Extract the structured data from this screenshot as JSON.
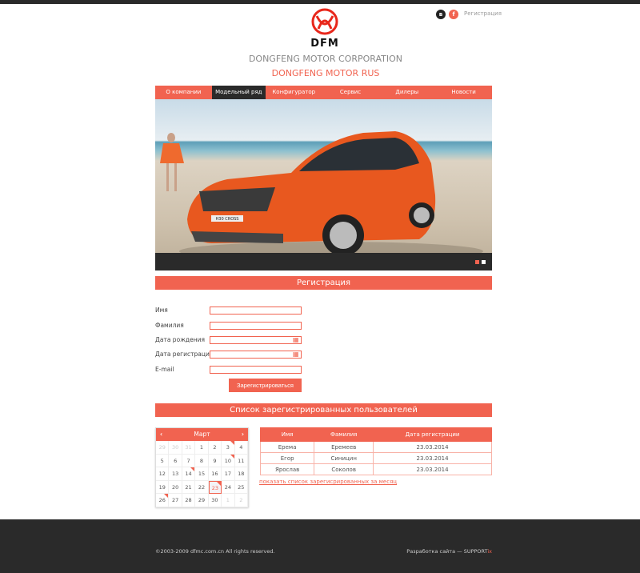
{
  "header": {
    "logo_text": "DFM",
    "social": [
      {
        "label": "в",
        "color": "#222"
      },
      {
        "label": "f",
        "color": "#f16350"
      }
    ],
    "register_link": "Регистрация",
    "title": "DONGFENG MOTOR CORPORATION",
    "subtitle": "DONGFENG MOTOR RUS"
  },
  "nav": [
    {
      "label": "О компании"
    },
    {
      "label": "Модельный ряд",
      "active": true
    },
    {
      "label": "Конфигуратор"
    },
    {
      "label": "Сервис"
    },
    {
      "label": "Дилеры"
    },
    {
      "label": "Новости"
    }
  ],
  "hero": {
    "badge": "H30 CROSS",
    "slides": 2,
    "active_slide": 1
  },
  "registration": {
    "heading": "Регистрация",
    "fields": [
      {
        "label": "Имя",
        "value": ""
      },
      {
        "label": "Фамилия",
        "value": ""
      },
      {
        "label": "Дата рождения",
        "value": "",
        "calendar": true
      },
      {
        "label": "Дата регистрации",
        "value": "",
        "calendar": true
      },
      {
        "label": "E-mail",
        "value": ""
      }
    ],
    "submit": "Зарегистрироваться"
  },
  "users": {
    "heading": "Список зарегистрированных пользователей",
    "calendar": {
      "month": "Март",
      "prev": "‹",
      "next": "›",
      "days": [
        [
          "29",
          "30",
          "31",
          "1",
          "2",
          "3",
          "4"
        ],
        [
          "5",
          "6",
          "7",
          "8",
          "9",
          "10",
          "11"
        ],
        [
          "12",
          "13",
          "14",
          "15",
          "16",
          "17",
          "18"
        ],
        [
          "19",
          "20",
          "21",
          "22",
          "23",
          "24",
          "25"
        ],
        [
          "26",
          "27",
          "28",
          "29",
          "30",
          "1",
          "2"
        ]
      ],
      "today": "23",
      "events": [
        "3",
        "10",
        "14",
        "23",
        "26"
      ]
    },
    "table": {
      "headers": [
        "Имя",
        "Фамилия",
        "Дата регистрации"
      ],
      "rows": [
        [
          "Ерема",
          "Еремеев",
          "23.03.2014"
        ],
        [
          "Егор",
          "Синицин",
          "23.03.2014"
        ],
        [
          "Ярослав",
          "Соколов",
          "23.03.2014"
        ]
      ]
    },
    "month_link": "показать список зарегисрированных за месяц"
  },
  "footer": {
    "copyright": "©2003-2009 dfmc.com.cn All rights reserved.",
    "dev_prefix": "Разработка сайта — ",
    "dev_brand": "SUPPORT",
    "dev_brand_suffix": "ix"
  }
}
